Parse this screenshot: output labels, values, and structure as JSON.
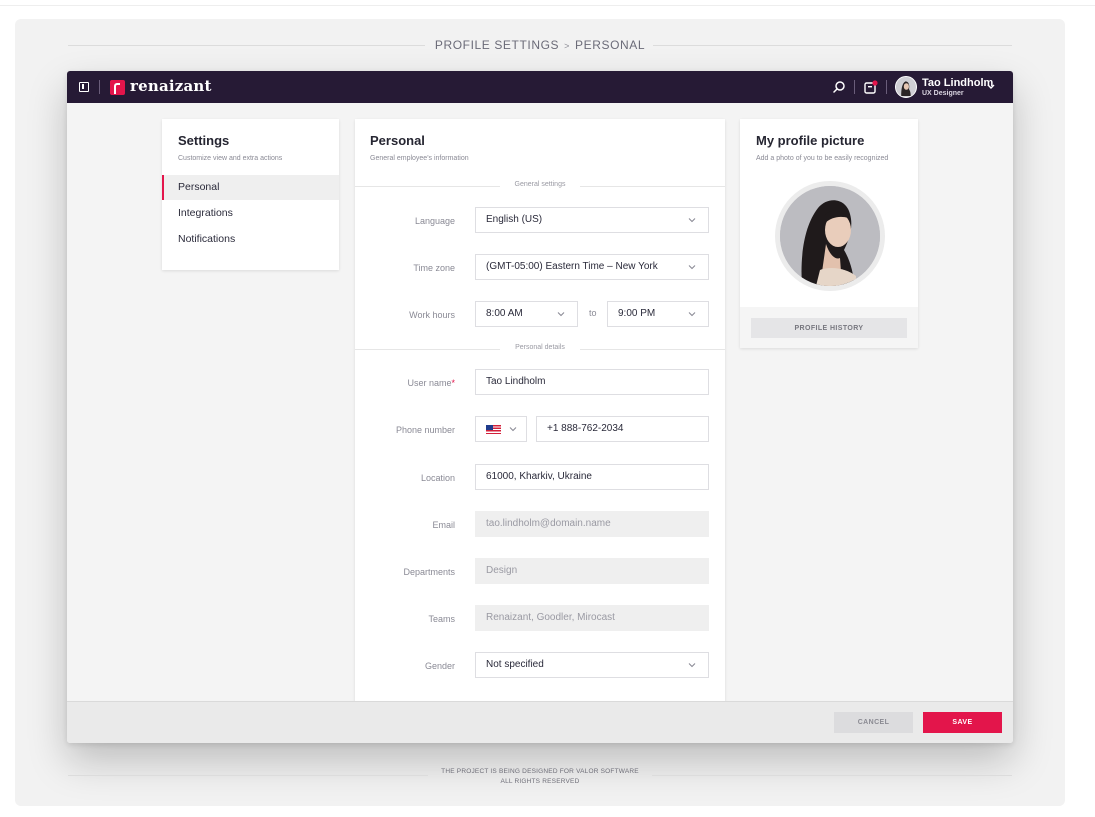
{
  "breadcrumb": {
    "root": "PROFILE SETTINGS",
    "separator": ">",
    "current": "PERSONAL"
  },
  "topbar": {
    "logo_text": "renaizant",
    "user": {
      "name": "Tao Lindholm",
      "role": "UX Designer"
    },
    "brand_color": "#e3154b",
    "bar_color": "#261a35"
  },
  "settings": {
    "title": "Settings",
    "subtitle": "Customize view and extra actions",
    "items": [
      {
        "label": "Personal",
        "active": true
      },
      {
        "label": "Integrations",
        "active": false
      },
      {
        "label": "Notifications",
        "active": false
      }
    ]
  },
  "personal": {
    "title": "Personal",
    "subtitle": "General employee's information",
    "section_general": "General settings",
    "section_details": "Personal details",
    "language": {
      "label": "Language",
      "value": "English (US)"
    },
    "timezone": {
      "label": "Time zone",
      "value": "(GMT-05:00) Eastern Time – New York"
    },
    "work_hours": {
      "label": "Work hours",
      "from": "8:00 AM",
      "to_label": "to",
      "to": "9:00 PM"
    },
    "username": {
      "label": "User name",
      "required_mark": "*",
      "value": "Tao Lindholm"
    },
    "phone": {
      "label": "Phone number",
      "value": "+1 888-762-2034"
    },
    "location": {
      "label": "Location",
      "value": "61000, Kharkiv, Ukraine"
    },
    "email": {
      "label": "Email",
      "value": "tao.lindholm@domain.name"
    },
    "departments": {
      "label": "Departments",
      "value": "Design"
    },
    "teams": {
      "label": "Teams",
      "value": "Renaizant, Goodler, Mirocast"
    },
    "gender": {
      "label": "Gender",
      "value": "Not specified"
    }
  },
  "picture": {
    "title": "My profile picture",
    "subtitle": "Add a photo of you to be easily recognized",
    "history_button": "PROFILE HISTORY"
  },
  "actions": {
    "cancel": "CANCEL",
    "save": "SAVE"
  },
  "page_footer": {
    "line1": "THE PROJECT IS BEING DESIGNED FOR VALOR SOFTWARE",
    "line2": "ALL RIGHTS RESERVED"
  }
}
